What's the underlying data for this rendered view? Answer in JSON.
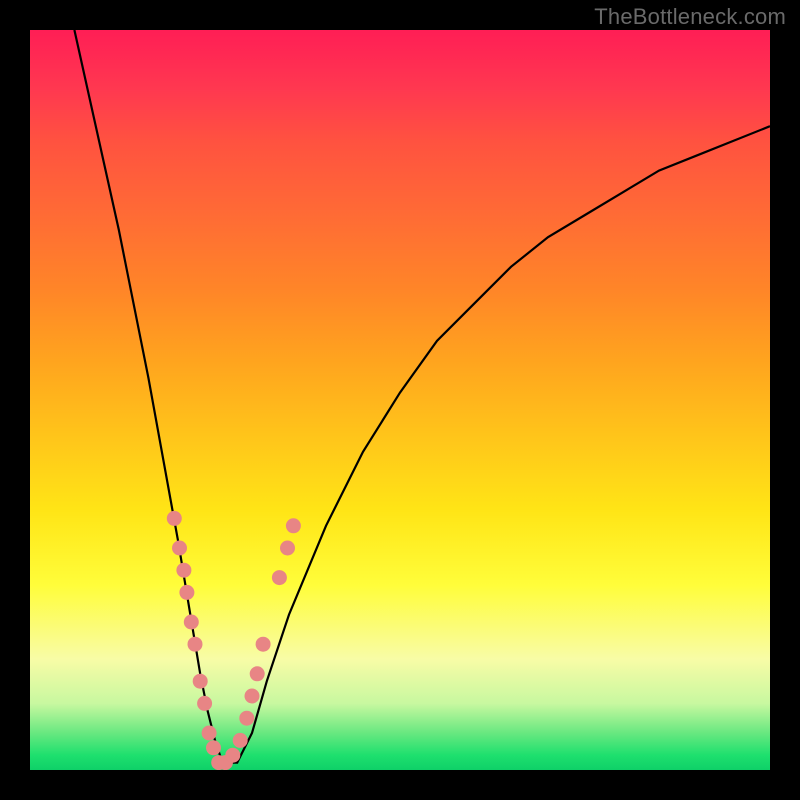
{
  "watermark": "TheBottleneck.com",
  "chart_data": {
    "type": "line",
    "title": "",
    "xlabel": "",
    "ylabel": "",
    "xlim": [
      0,
      100
    ],
    "ylim": [
      0,
      100
    ],
    "grid": false,
    "series": [
      {
        "name": "bottleneck-curve",
        "x": [
          6,
          8,
          10,
          12,
          14,
          16,
          18,
          20,
          21,
          22,
          23,
          24,
          25,
          26,
          28,
          30,
          32,
          35,
          40,
          45,
          50,
          55,
          60,
          65,
          70,
          75,
          80,
          85,
          90,
          95,
          100
        ],
        "y": [
          100,
          91,
          82,
          73,
          63,
          53,
          42,
          31,
          25,
          19,
          13,
          8,
          4,
          1,
          1,
          5,
          12,
          21,
          33,
          43,
          51,
          58,
          63,
          68,
          72,
          75,
          78,
          81,
          83,
          85,
          87
        ]
      }
    ],
    "markers": {
      "name": "data-marker",
      "color": "#e88585",
      "points": [
        {
          "x": 19.5,
          "y": 34
        },
        {
          "x": 20.2,
          "y": 30
        },
        {
          "x": 20.8,
          "y": 27
        },
        {
          "x": 21.2,
          "y": 24
        },
        {
          "x": 21.8,
          "y": 20
        },
        {
          "x": 22.3,
          "y": 17
        },
        {
          "x": 23.0,
          "y": 12
        },
        {
          "x": 23.6,
          "y": 9
        },
        {
          "x": 24.2,
          "y": 5
        },
        {
          "x": 24.8,
          "y": 3
        },
        {
          "x": 25.5,
          "y": 1
        },
        {
          "x": 26.4,
          "y": 1
        },
        {
          "x": 27.4,
          "y": 2
        },
        {
          "x": 28.4,
          "y": 4
        },
        {
          "x": 29.3,
          "y": 7
        },
        {
          "x": 30.0,
          "y": 10
        },
        {
          "x": 30.7,
          "y": 13
        },
        {
          "x": 31.5,
          "y": 17
        },
        {
          "x": 33.7,
          "y": 26
        },
        {
          "x": 34.8,
          "y": 30
        },
        {
          "x": 35.6,
          "y": 33
        }
      ]
    }
  }
}
